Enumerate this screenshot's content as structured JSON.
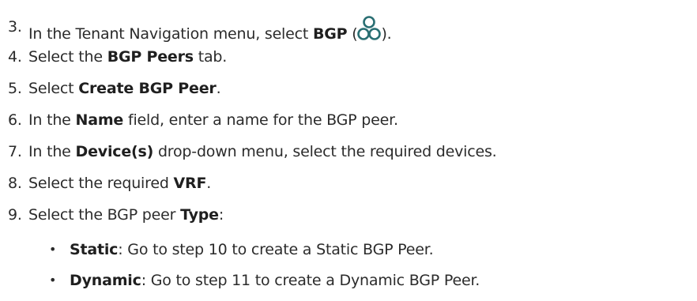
{
  "steps": [
    {
      "num": "3.",
      "pre": "In the Tenant Navigation menu, select ",
      "bold": "BGP",
      "mid": " (",
      "post": ").",
      "icon": "bgp-icon"
    },
    {
      "num": "4.",
      "pre": "Select the ",
      "bold": "BGP Peers",
      "post": " tab."
    },
    {
      "num": "5.",
      "pre": "Select ",
      "bold": "Create BGP Peer",
      "post": "."
    },
    {
      "num": "6.",
      "pre": "In the ",
      "bold": "Name",
      "post": " field, enter a name for the BGP peer."
    },
    {
      "num": "7.",
      "pre": "In the ",
      "bold": "Device(s)",
      "post": " drop-down menu, select the required devices."
    },
    {
      "num": "8.",
      "pre": "Select the required ",
      "bold": "VRF",
      "post": "."
    },
    {
      "num": "9.",
      "pre": "Select the BGP peer ",
      "bold": "Type",
      "post": ":"
    }
  ],
  "substeps": [
    {
      "bullet": "•",
      "bold": "Static",
      "post": ": Go to step 10 to create a Static BGP Peer."
    },
    {
      "bullet": "•",
      "bold": "Dynamic",
      "post": ": Go to step 11 to create a Dynamic BGP Peer."
    }
  ],
  "colors": {
    "icon": "#2a6f73",
    "text": "#2b2b2b"
  }
}
